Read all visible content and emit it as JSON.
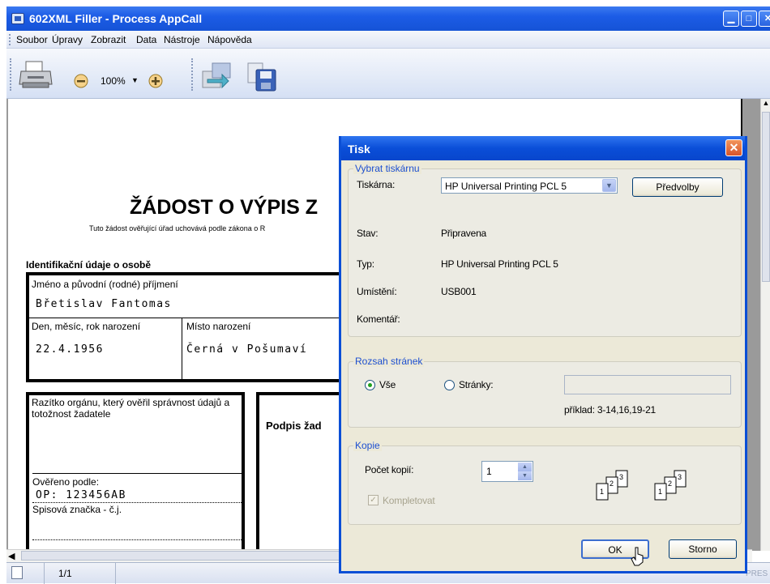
{
  "window": {
    "title": "602XML Filler - Process AppCall",
    "menu": [
      "Soubor",
      "Úpravy",
      "Zobrazit",
      "Data",
      "Nástroje",
      "Nápověda"
    ]
  },
  "toolbar": {
    "zoom": "100%"
  },
  "document": {
    "heading": "ŽÁDOST O VÝPIS Z",
    "subtitle": "Tuto žádost ověřující úřad uchovává podle zákona o R",
    "section_title": "Identifikační údaje o osobě",
    "name_label": "Jméno a původní (rodné) příjmení",
    "name_value": "Břetislav Fantomas",
    "dob_label": "Den, měsíc, rok narození",
    "dob_value": "22.4.1956",
    "birthplace_label": "Místo narození",
    "birthplace_value": "Černá v Pošumaví",
    "stamp_label": "Razítko orgánu, který ověřil správnost údajů a totožnost žadatele",
    "signature_label": "Podpis žad",
    "verified_label": "Ověřeno podle:",
    "verified_value": "OP: 123456AB",
    "file_label": "Spisová značka - č.j."
  },
  "statusbar": {
    "page": "1/1",
    "mode": "PRES"
  },
  "dialog": {
    "title": "Tisk",
    "printer_group": "Vybrat tiskárnu",
    "printer_label": "Tiskárna:",
    "printer_value": "HP Universal Printing PCL 5",
    "preferences_button": "Předvolby",
    "status_label": "Stav:",
    "status_value": "Připravena",
    "type_label": "Typ:",
    "type_value": "HP Universal Printing PCL 5",
    "location_label": "Umístění:",
    "location_value": "USB001",
    "comment_label": "Komentář:",
    "range_group": "Rozsah stránek",
    "all_label": "Vše",
    "pages_label": "Stránky:",
    "example": "příklad: 3-14,16,19-21",
    "copies_group": "Kopie",
    "copies_label": "Počet kopií:",
    "copies_value": "1",
    "collate_label": "Kompletovat",
    "ok_button": "OK",
    "cancel_button": "Storno"
  },
  "colors": {
    "titlebar": "#1c5ce6",
    "dialog_legend": "#1d4fd0",
    "dialog_bg": "#ece9d8"
  }
}
